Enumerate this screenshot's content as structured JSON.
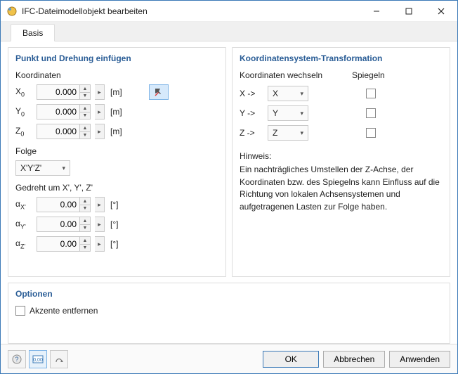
{
  "window": {
    "title": "IFC-Dateimodellobjekt bearbeiten"
  },
  "tabs": {
    "basis": "Basis"
  },
  "insert": {
    "legend": "Punkt und Drehung einfügen",
    "coords_label": "Koordinaten",
    "x_label": "X",
    "y_label": "Y",
    "z_label": "Z",
    "sub0": "0",
    "x_value": "0.000",
    "y_value": "0.000",
    "z_value": "0.000",
    "unit_m": "[m]",
    "folge_label": "Folge",
    "folge_value": "X'Y'Z'",
    "rot_label": "Gedreht um X', Y', Z'",
    "ax_label": "α",
    "ax_x": "X'",
    "ax_y": "Y'",
    "ax_z": "Z'",
    "ax_x_value": "0.00",
    "ax_y_value": "0.00",
    "ax_z_value": "0.00",
    "unit_deg": "[°]"
  },
  "transform": {
    "legend": "Koordinatensystem-Transformation",
    "swap_label": "Koordinaten wechseln",
    "mirror_label": "Spiegeln",
    "x_from": "X ->",
    "y_from": "Y ->",
    "z_from": "Z ->",
    "x_to": "X",
    "y_to": "Y",
    "z_to": "Z",
    "note_head": "Hinweis:",
    "note_body": "Ein nachträgliches Umstellen der Z-Achse, der Koordinaten bzw. des Spiegelns kann Einfluss auf die Richtung von lokalen Achsensystemen und aufgetragenen Lasten zur Folge haben."
  },
  "options": {
    "legend": "Optionen",
    "remove_accents": "Akzente entfernen"
  },
  "footer": {
    "ok": "OK",
    "cancel": "Abbrechen",
    "apply": "Anwenden"
  }
}
